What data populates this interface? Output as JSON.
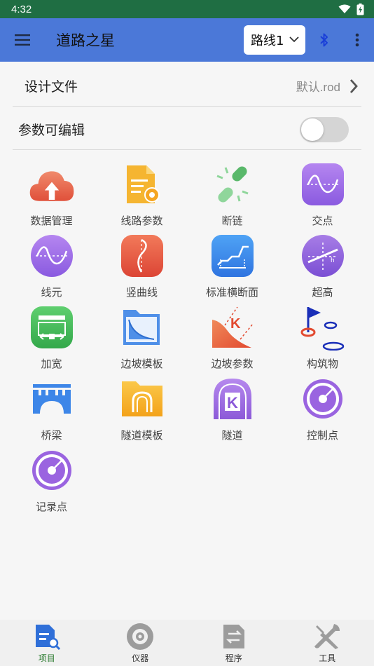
{
  "status_bar": {
    "time": "4:32"
  },
  "app_bar": {
    "title": "道路之星",
    "route_selected": "路线1"
  },
  "design_file": {
    "label": "设计文件",
    "value": "默认.rod"
  },
  "editable": {
    "label": "参数可编辑",
    "on": false
  },
  "tiles": [
    {
      "label": "数据管理",
      "icon": "cloud-upload-icon"
    },
    {
      "label": "线路参数",
      "icon": "document-gear-icon"
    },
    {
      "label": "断链",
      "icon": "broken-link-icon"
    },
    {
      "label": "交点",
      "icon": "sine-wave-icon"
    },
    {
      "label": "线元",
      "icon": "sine-wave-icon"
    },
    {
      "label": "竖曲线",
      "icon": "vertical-curve-icon"
    },
    {
      "label": "标准横断面",
      "icon": "cross-section-icon"
    },
    {
      "label": "超高",
      "icon": "superelevation-icon"
    },
    {
      "label": "加宽",
      "icon": "widening-icon"
    },
    {
      "label": "边坡模板",
      "icon": "slope-folder-icon"
    },
    {
      "label": "边坡参数",
      "icon": "slope-k-icon"
    },
    {
      "label": "构筑物",
      "icon": "flag-structure-icon"
    },
    {
      "label": "桥梁",
      "icon": "bridge-icon"
    },
    {
      "label": "隧道模板",
      "icon": "tunnel-folder-icon"
    },
    {
      "label": "隧道",
      "icon": "tunnel-k-icon"
    },
    {
      "label": "控制点",
      "icon": "target-icon"
    },
    {
      "label": "记录点",
      "icon": "target-icon"
    }
  ],
  "bottom_nav": [
    {
      "label": "项目",
      "icon": "project-doc-icon",
      "active": true
    },
    {
      "label": "仪器",
      "icon": "instrument-icon",
      "active": false
    },
    {
      "label": "程序",
      "icon": "program-icon",
      "active": false
    },
    {
      "label": "工具",
      "icon": "tools-icon",
      "active": false
    }
  ],
  "colors": {
    "status_bar": "#1f6e43",
    "app_bar": "#4b78d8",
    "nav_active": "#2e7d32"
  }
}
